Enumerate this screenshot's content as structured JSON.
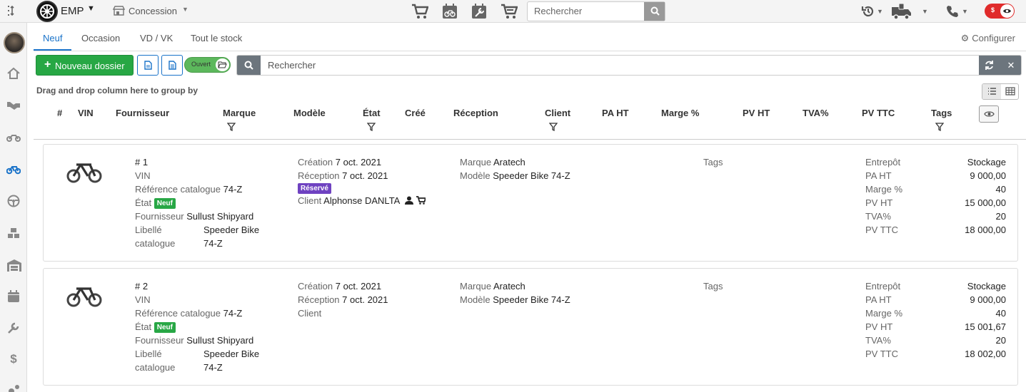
{
  "topbar": {
    "brand": "EMP",
    "concession": "Concession",
    "search_placeholder": "Rechercher",
    "icons": [
      "cart-icon",
      "calendar-bike-icon",
      "wrench-calendar-icon",
      "cart-moto-icon"
    ],
    "money_toggle_symbol": "$"
  },
  "sidebar": {
    "items": [
      "home-icon",
      "handshake-icon",
      "motorcycle-icon",
      "bicycle-icon",
      "steering-wheel-icon",
      "parts-icon",
      "warehouse-icon",
      "calendar-icon",
      "wrench-icon",
      "dollar-icon",
      "gears-icon"
    ],
    "dollar_glyph": "$"
  },
  "tabs": [
    {
      "label": "Neuf",
      "active": true
    },
    {
      "label": "Occasion"
    },
    {
      "label": "VD / VK"
    },
    {
      "label": "Tout le stock"
    }
  ],
  "configure_label": "Configurer",
  "toolbar": {
    "new_label": "Nouveau dossier",
    "open_toggle_label": "Ouvert",
    "search_placeholder": "Rechercher"
  },
  "group_hint": "Drag and drop column here to group by",
  "columns": {
    "num": "#",
    "vin": "VIN",
    "fournisseur": "Fournisseur",
    "marque": "Marque",
    "modele": "Modèle",
    "etat": "État",
    "cree": "Créé",
    "reception": "Réception",
    "client": "Client",
    "pa_ht": "PA HT",
    "marge": "Marge %",
    "pv_ht": "PV HT",
    "tva": "TVA%",
    "pv_ttc": "PV TTC",
    "tags": "Tags"
  },
  "labels": {
    "vin": "VIN",
    "ref": "Référence catalogue",
    "etat": "État",
    "fournisseur": "Fournisseur",
    "libelle1": "Libellé",
    "libelle2": "catalogue",
    "creation": "Création",
    "reception": "Réception",
    "client": "Client",
    "marque": "Marque",
    "modele": "Modèle",
    "tags": "Tags",
    "entrepot": "Entrepôt",
    "pa_ht": "PA HT",
    "marge": "Marge %",
    "pv_ht": "PV HT",
    "tva": "TVA%",
    "pv_ttc": "PV TTC"
  },
  "rows": [
    {
      "num": "# 1",
      "ref": "74-Z",
      "etat_badge": "Neuf",
      "fournisseur": "Sullust Shipyard",
      "libelle1": "Speeder Bike",
      "libelle2": "74-Z",
      "creation": "7 oct. 2021",
      "reception": "7 oct. 2021",
      "status_badge": "Réservé",
      "client": "Alphonse DANLTA",
      "marque": "Aratech",
      "modele": "Speeder Bike 74-Z",
      "entrepot": "Stockage",
      "pa_ht": "9 000,00",
      "marge": "40",
      "pv_ht": "15 000,00",
      "tva": "20",
      "pv_ttc": "18 000,00"
    },
    {
      "num": "# 2",
      "ref": "74-Z",
      "etat_badge": "Neuf",
      "fournisseur": "Sullust Shipyard",
      "libelle1": "Speeder Bike",
      "libelle2": "74-Z",
      "creation": "7 oct. 2021",
      "reception": "7 oct. 2021",
      "client": "",
      "marque": "Aratech",
      "modele": "Speeder Bike 74-Z",
      "entrepot": "Stockage",
      "pa_ht": "9 000,00",
      "marge": "40",
      "pv_ht": "15 001,67",
      "tva": "20",
      "pv_ttc": "18 002,00"
    }
  ],
  "colors": {
    "primary": "#1a73c9",
    "success": "#28a745",
    "reserved": "#6f42c1",
    "danger": "#e02b2b",
    "muted_button": "#6c757d"
  }
}
